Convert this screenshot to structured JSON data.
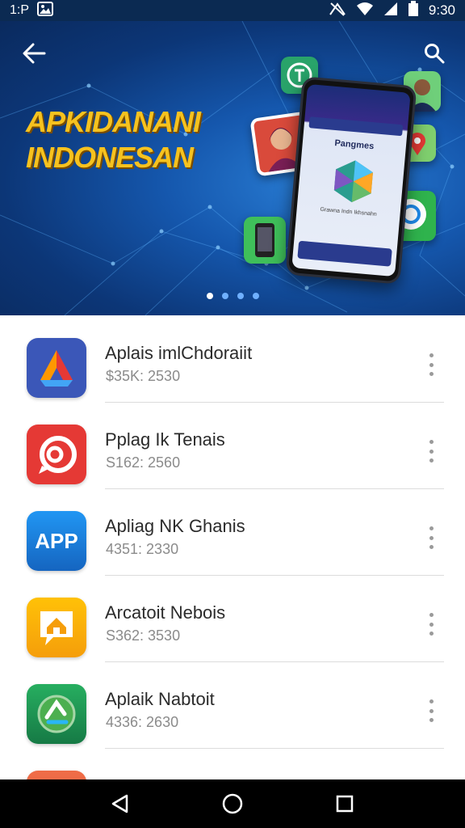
{
  "status_bar": {
    "left_text": "1:P",
    "time": "9:30",
    "icons": [
      "image-icon",
      "no-signal-icon",
      "wifi-icon",
      "signal-icon",
      "battery-icon"
    ]
  },
  "banner": {
    "title_line1": "APKIDANANI",
    "title_line2": "INDONESAN",
    "phone_title": "Pangmes",
    "phone_sub": "Grawna Indn Ikhsnahn",
    "title_color": "#f6c21f",
    "carousel": {
      "count": 4,
      "active": 0
    }
  },
  "apps": [
    {
      "name": "Aplais imlChdoraiit",
      "meta": "$35K: 2530",
      "icon": "drive-triangle-icon",
      "color": "#3b57b8"
    },
    {
      "name": "Pplag Ik Tenais",
      "meta": "S162: 2560",
      "icon": "ring-chat-icon",
      "color": "#e53935"
    },
    {
      "name": "Apliag NK Ghanis",
      "meta": "4351: 2330",
      "icon": "app-text-icon",
      "color": "#1e88e5",
      "icon_text": "APP"
    },
    {
      "name": "Arcatoit Nebois",
      "meta": "S362: 3530",
      "icon": "home-chat-icon",
      "color": "#f5b014"
    },
    {
      "name": "Aplaik Nabtoit",
      "meta": "4336: 2630",
      "icon": "recycle-globe-icon",
      "color": "#1f9e5a"
    }
  ],
  "nav_bar": {
    "buttons": [
      "back-triangle-icon",
      "home-circle-icon",
      "recents-square-icon"
    ]
  }
}
